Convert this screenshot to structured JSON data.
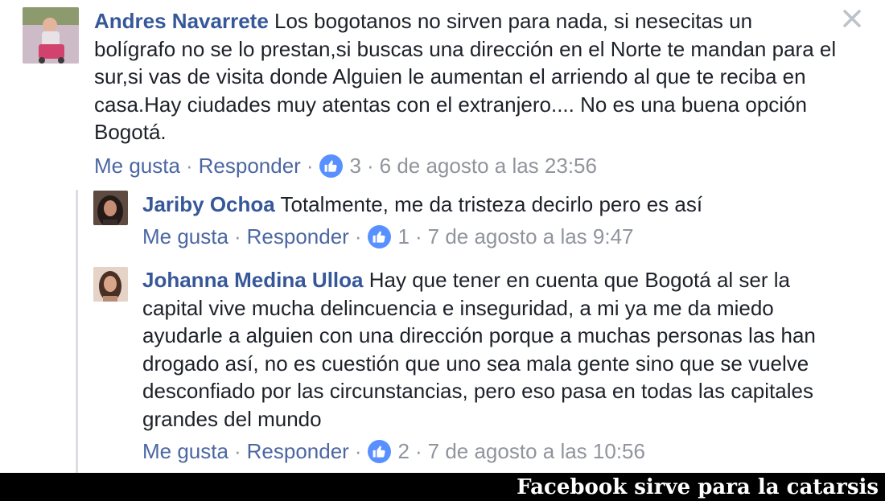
{
  "comments": [
    {
      "author": "Andres Navarrete",
      "text": "Los bogotanos no sirven para nada, si nesecitas un bolígrafo no se lo prestan,si buscas una dirección en el Norte te mandan para el sur,si vas de visita donde Alguien le aumentan el arriendo al que te reciba en casa.Hay ciudades muy atentas con el extranjero.... No es una buena opción Bogotá.",
      "like_label": "Me gusta",
      "reply_label": "Responder",
      "reaction_count": "3",
      "timestamp": "6 de agosto a las 23:56"
    }
  ],
  "replies": [
    {
      "author": "Jariby Ochoa",
      "text": "Totalmente, me da tristeza decirlo pero es así",
      "like_label": "Me gusta",
      "reply_label": "Responder",
      "reaction_count": "1",
      "timestamp": "7 de agosto a las 9:47"
    },
    {
      "author": "Johanna Medina Ulloa",
      "text": "Hay que tener en cuenta que Bogotá al ser la capital vive mucha delincuencia e inseguridad, a mi ya me da miedo ayudarle a alguien con una dirección porque a muchas personas las han drogado así, no es cuestión que uno sea mala gente sino que se vuelve desconfiado por las circunstancias, pero eso pasa en todas las capitales grandes del mundo",
      "like_label": "Me gusta",
      "reply_label": "Responder",
      "reaction_count": "2",
      "timestamp": "7 de agosto a las 10:56"
    }
  ],
  "caption": "Facebook sirve para la catarsis",
  "icons": {
    "close": "close-icon",
    "reaction": "thumbs-up-icon"
  },
  "colors": {
    "author": "#365899",
    "meta": "#90949c",
    "reaction_badge": "#5890ff",
    "banner_bg": "#000000"
  }
}
